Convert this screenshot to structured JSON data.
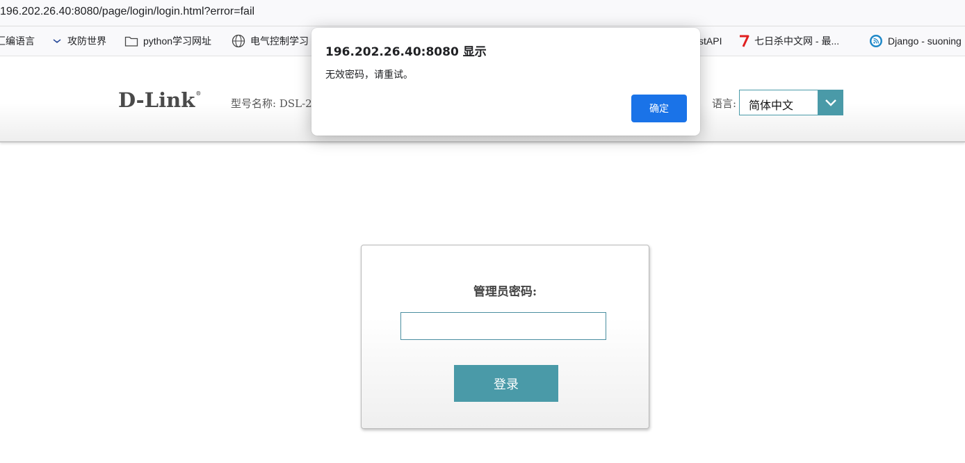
{
  "browser": {
    "address": "196.202.26.40:8080/page/login/login.html?error=fail",
    "bookmarks": [
      {
        "label": "汇编语言",
        "icon": "none"
      },
      {
        "label": "攻防世界",
        "icon": "xctf-icon"
      },
      {
        "label": "python学习网址",
        "icon": "folder-icon"
      },
      {
        "label": "电气控制学习",
        "icon": "globe-icon"
      },
      {
        "label": "stAPI",
        "icon": "none"
      },
      {
        "label": "七日杀中文网 - 最...",
        "icon": "seven-icon"
      },
      {
        "label": "Django - suoning",
        "icon": "cnblogs-icon"
      }
    ]
  },
  "header": {
    "logo": "D-Link",
    "logo_mark": "®",
    "model_label": "型号名称: DSL-2",
    "language_label": "语言:",
    "language_value": "简体中文"
  },
  "login": {
    "password_label": "管理员密码:",
    "password_value": "",
    "login_button": "登录"
  },
  "dialog": {
    "title": "196.202.26.40:8080 显示",
    "message": "无效密码，请重试。",
    "ok_label": "确定"
  },
  "colors": {
    "accent": "#4a9aa8",
    "dialog_button": "#1a73e8"
  }
}
